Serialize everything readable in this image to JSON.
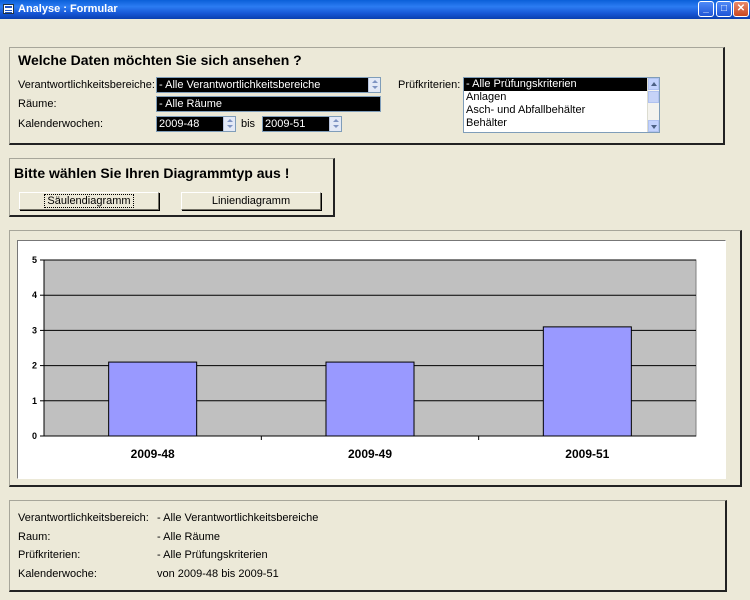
{
  "window": {
    "title": "Analyse : Formular"
  },
  "filters": {
    "heading": "Welche Daten möchten Sie sich ansehen ?",
    "verantwortlich_label": "Verantwortlichkeitsbereiche:",
    "verantwortlich_value": "- Alle Verantwortlichkeitsbereiche",
    "raeume_label": "Räume:",
    "raeume_value": "- Alle Räume",
    "kw_label": "Kalenderwochen:",
    "kw_from": "2009-48",
    "kw_bis": "bis",
    "kw_to": "2009-51",
    "pruef_label": "Prüfkriterien:",
    "pruef_items": [
      "- Alle Prüfungskriterien",
      "Anlagen",
      "Asch- und Abfallbehälter",
      "Behälter"
    ]
  },
  "diagram_type": {
    "heading": "Bitte wählen Sie Ihren Diagrammtyp aus !",
    "bar_button": "Säulendiagramm",
    "line_button": "Liniendiagramm"
  },
  "chart_data": {
    "type": "bar",
    "categories": [
      "2009-48",
      "2009-49",
      "2009-51"
    ],
    "values": [
      2.1,
      2.1,
      3.1
    ],
    "ylim": [
      0,
      5
    ],
    "yticks": [
      "0",
      "1",
      "2",
      "3",
      "4",
      "5"
    ],
    "grid": true,
    "colors": {
      "bar": "#9999FF",
      "plot_bg": "#C0C0C0"
    }
  },
  "summary": {
    "verantwortlich_label": "Verantwortlichkeitsbereich:",
    "verantwortlich_value": "- Alle Verantwortlichkeitsbereiche",
    "raum_label": "Raum:",
    "raum_value": "- Alle Räume",
    "pruef_label": "Prüfkriterien:",
    "pruef_value": "- Alle Prüfungskriterien",
    "kw_label": "Kalenderwoche:",
    "kw_value": "von 2009-48 bis 2009-51"
  }
}
